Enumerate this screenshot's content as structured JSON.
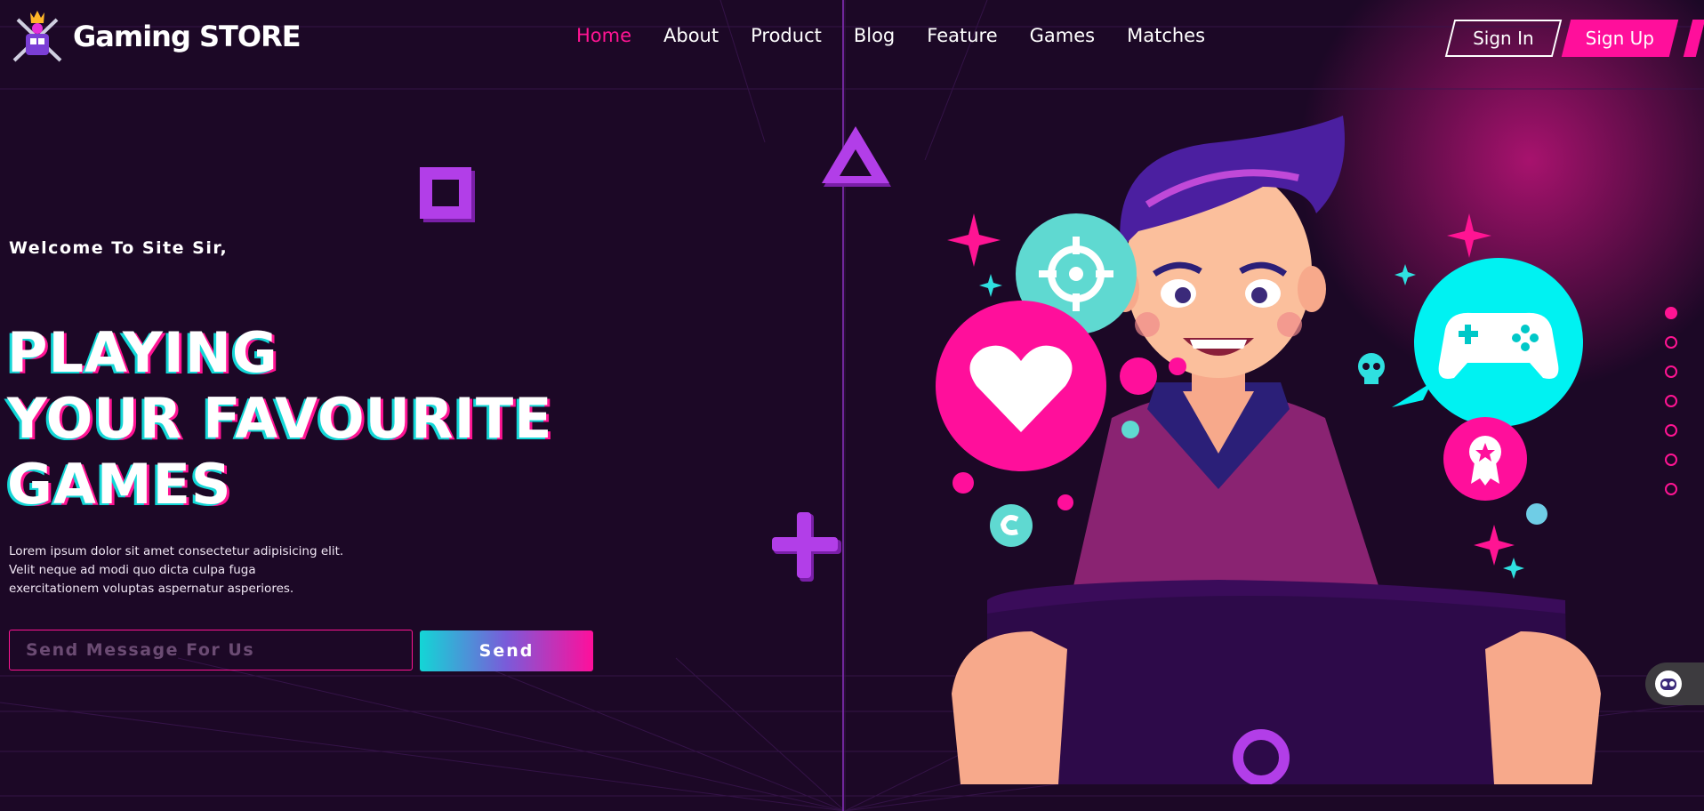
{
  "brand": {
    "name": "Gaming STORE",
    "logo_icon": "crossed-swords-crown-logo"
  },
  "nav": {
    "items": [
      {
        "label": "Home",
        "active": true
      },
      {
        "label": "About",
        "active": false
      },
      {
        "label": "Product",
        "active": false
      },
      {
        "label": "Blog",
        "active": false
      },
      {
        "label": "Feature",
        "active": false
      },
      {
        "label": "Games",
        "active": false
      },
      {
        "label": "Matches",
        "active": false
      }
    ]
  },
  "auth": {
    "sign_in": "Sign In",
    "sign_up": "Sign Up"
  },
  "hero": {
    "welcome": "Welcome To Site Sir,",
    "headline": [
      "PLAYING",
      "YOUR FAVOURITE",
      "GAMES"
    ],
    "description": "Lorem ipsum dolor sit amet consectetur adipisicing elit. Velit neque ad modi quo dicta culpa fuga exercitationem voluptas aspernatur asperiores.",
    "input_placeholder": "Send Message For Us",
    "send_label": "Send"
  },
  "slider": {
    "count": 7,
    "active_index": 0
  },
  "colors": {
    "accent": "#ff1493",
    "cyan": "#13d6d6",
    "purple": "#b23ee8",
    "background": "#1c0826"
  },
  "icons": [
    "square-shape-icon",
    "triangle-shape-icon",
    "plus-shape-icon",
    "circle-shape-icon",
    "target-icon",
    "heart-icon",
    "gamepad-icon",
    "award-badge-icon",
    "skull-icon",
    "coin-icon",
    "chat-bot-icon"
  ]
}
